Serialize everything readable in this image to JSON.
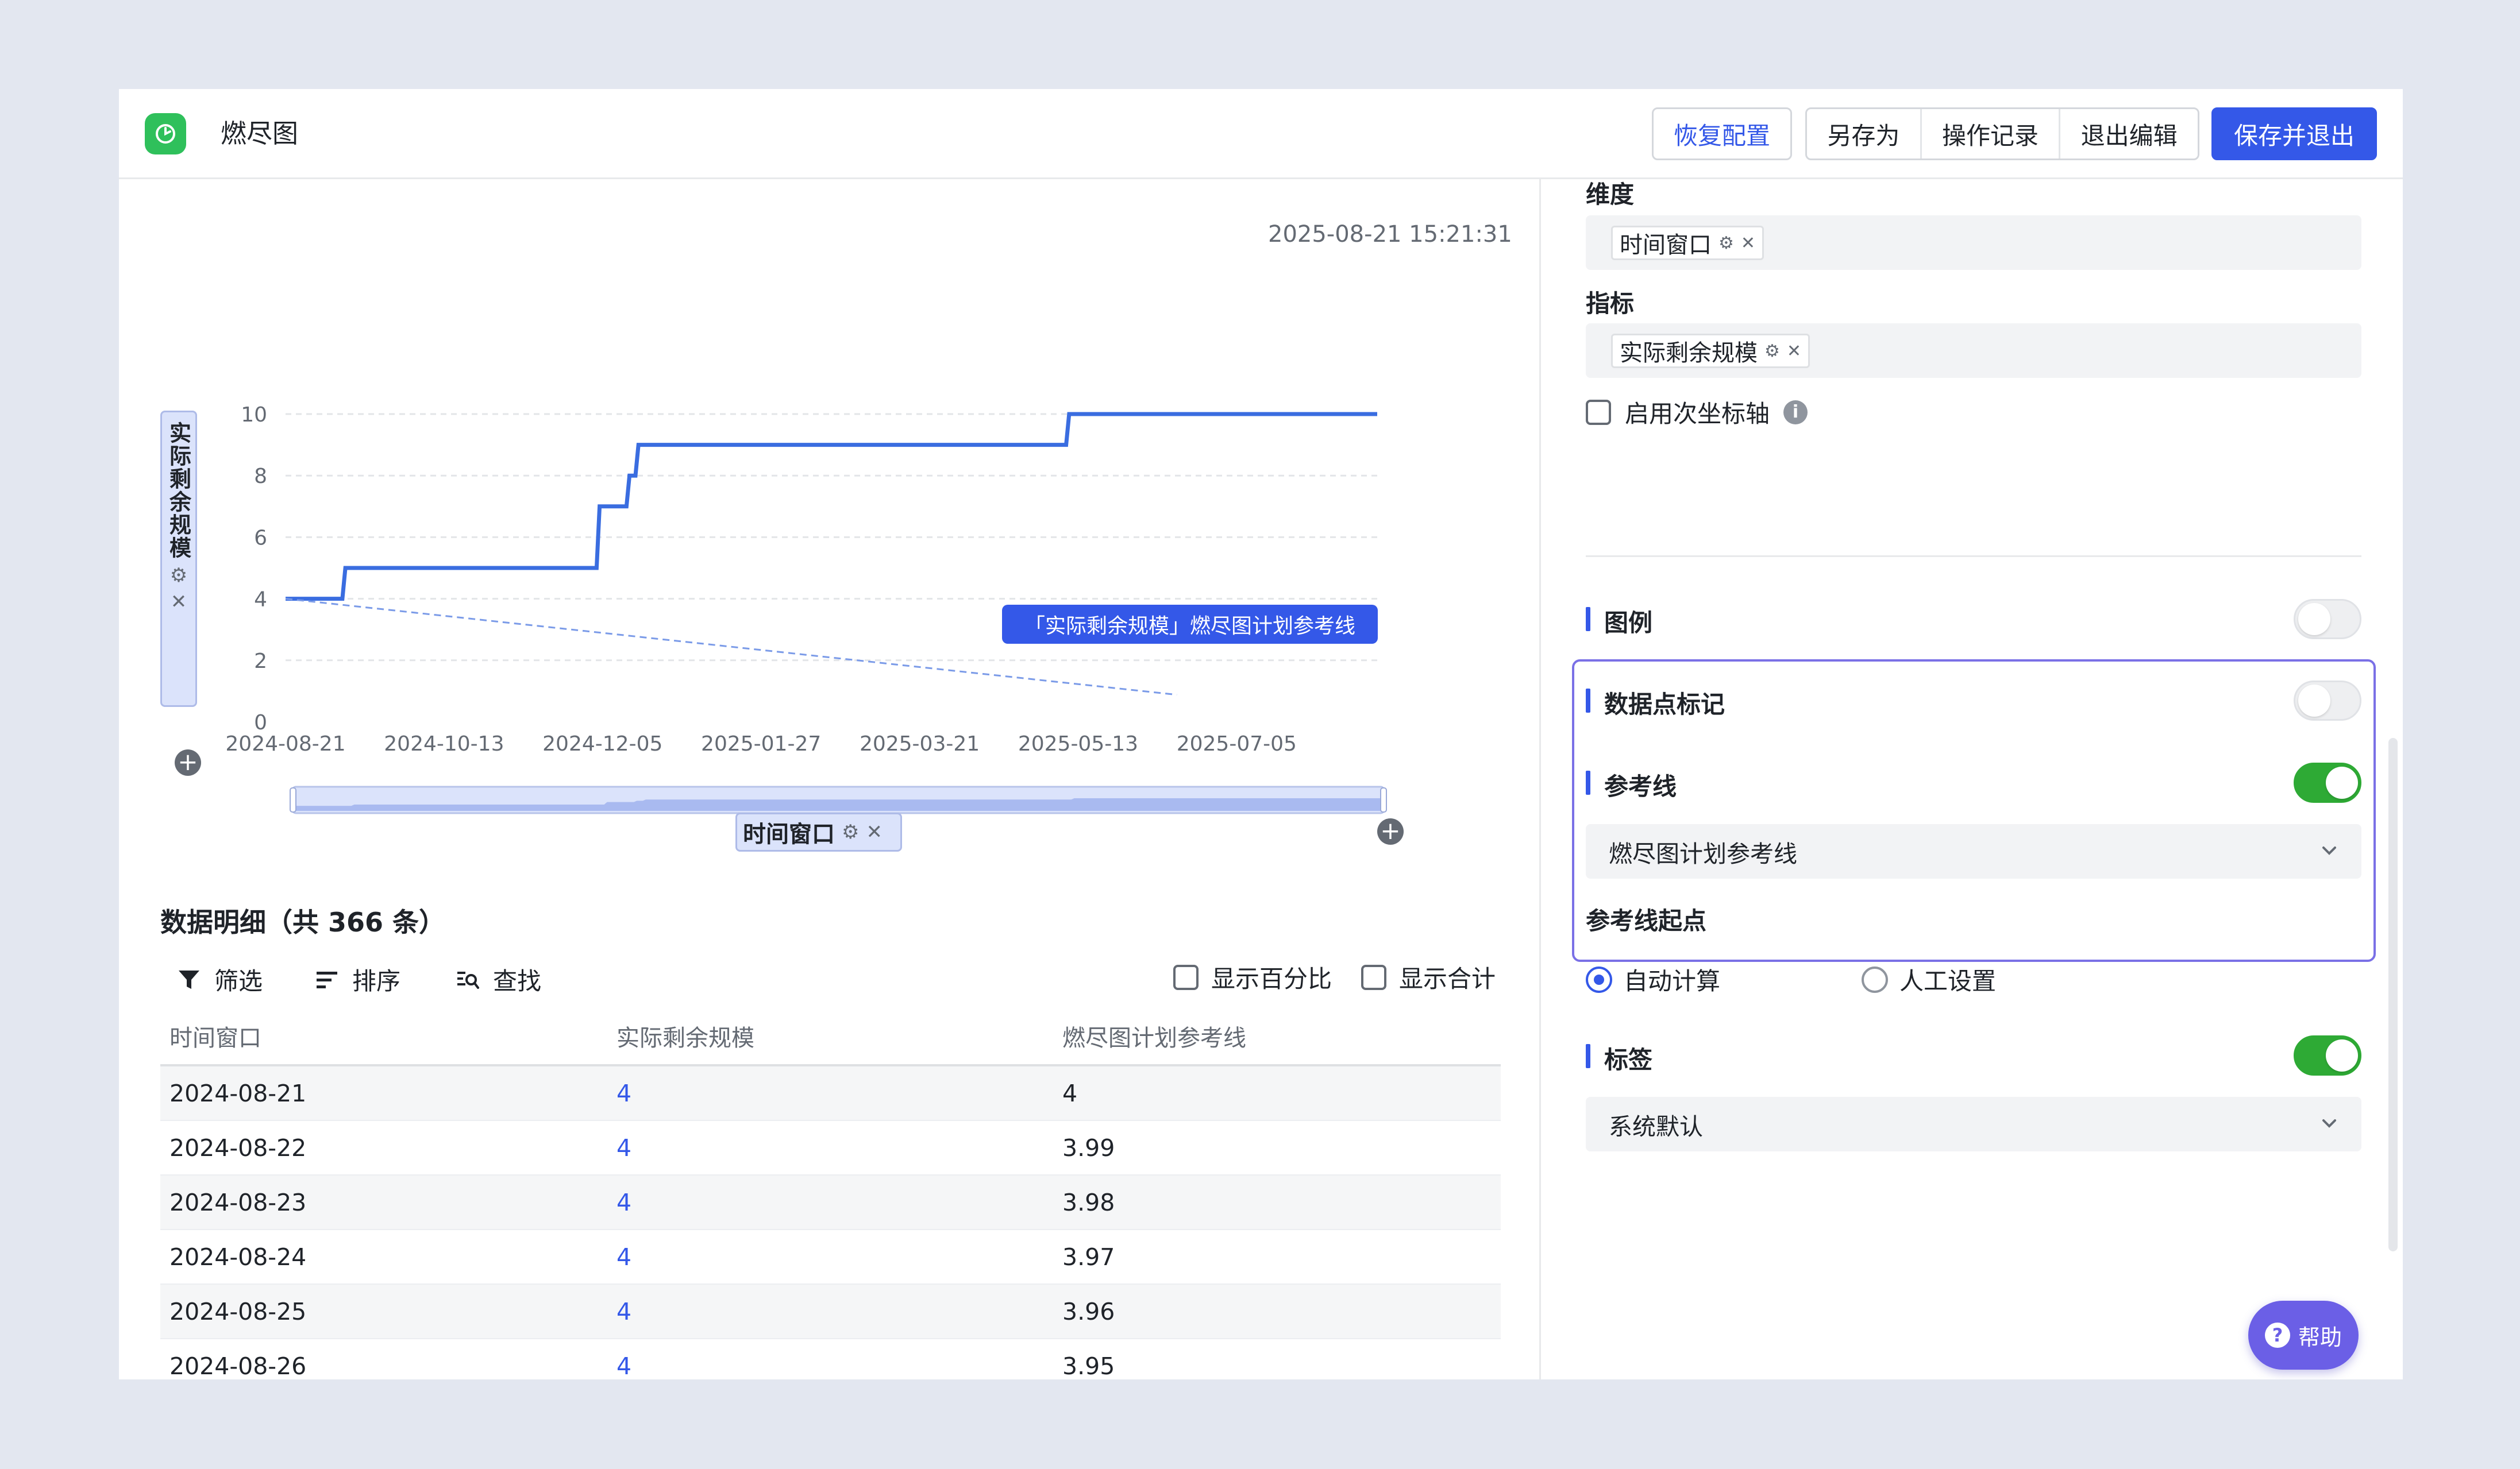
{
  "header": {
    "title": "燃尽图",
    "buttons": {
      "restore": "恢复配置",
      "save_as": "另存为",
      "history": "操作记录",
      "exit_edit": "退出编辑",
      "save_exit": "保存并退出"
    }
  },
  "chart": {
    "timestamp": "2025-08-21 15:21:31",
    "y_axis_field": "实际剩余规模",
    "x_axis_field": "时间窗口",
    "reference_tooltip": "「实际剩余规模」燃尽图计划参考线",
    "icons": {
      "settings": "gear-icon",
      "remove": "close-icon",
      "add": "plus-circle-icon"
    }
  },
  "chart_data": {
    "type": "line",
    "xlabel": "时间窗口",
    "ylabel": "实际剩余规模",
    "x_ticks": [
      "2024-08-21",
      "2024-10-13",
      "2024-12-05",
      "2025-01-27",
      "2025-03-21",
      "2025-05-13",
      "2025-07-05"
    ],
    "y_ticks": [
      0,
      2,
      4,
      6,
      8,
      10
    ],
    "xlim": [
      "2024-08-21",
      "2025-08-21"
    ],
    "ylim": [
      0,
      10
    ],
    "grid": true,
    "series": [
      {
        "name": "实际剩余规模",
        "style": "step",
        "color": "#3a6de0",
        "x": [
          "2024-08-21",
          "2024-09-09",
          "2024-09-10",
          "2024-12-03",
          "2024-12-04",
          "2024-12-13",
          "2024-12-14",
          "2024-12-16",
          "2024-12-17",
          "2025-05-09",
          "2025-05-10",
          "2025-08-21"
        ],
        "y": [
          4,
          4,
          5,
          5,
          7,
          7,
          8,
          8,
          9,
          9,
          10,
          10
        ]
      },
      {
        "name": "燃尽图计划参考线",
        "style": "dashed",
        "color": "#7b9be8",
        "x": [
          "2024-08-21",
          "2025-06-15"
        ],
        "y": [
          4,
          0.88
        ]
      }
    ]
  },
  "detail": {
    "title": "数据明细（共 366 条）",
    "toolbar": {
      "filter": "筛选",
      "sort": "排序",
      "find": "查找"
    },
    "options": {
      "show_percent": "显示百分比",
      "show_total": "显示合计"
    },
    "columns": [
      "时间窗口",
      "实际剩余规模",
      "燃尽图计划参考线"
    ],
    "rows": [
      [
        "2024-08-21",
        "4",
        "4"
      ],
      [
        "2024-08-22",
        "4",
        "3.99"
      ],
      [
        "2024-08-23",
        "4",
        "3.98"
      ],
      [
        "2024-08-24",
        "4",
        "3.97"
      ],
      [
        "2024-08-25",
        "4",
        "3.96"
      ],
      [
        "2024-08-26",
        "4",
        "3.95"
      ]
    ]
  },
  "panel": {
    "dimension_label": "维度",
    "dimension_tag": "时间窗口",
    "metric_label": "指标",
    "metric_tag": "实际剩余规模",
    "secondary_axis": "启用次坐标轴",
    "legend": "图例",
    "data_point_marker": "数据点标记",
    "reference_line": "参考线",
    "reference_line_select": "燃尽图计划参考线",
    "reference_start_label": "参考线起点",
    "start_auto": "自动计算",
    "start_manual": "人工设置",
    "labels": "标签",
    "labels_select": "系统默认",
    "help": "帮助",
    "toggles": {
      "legend": false,
      "data_point_marker": false,
      "reference_line": true,
      "labels": true
    },
    "start_mode": "自动计算"
  },
  "colors": {
    "accent": "#3458e8",
    "toggle_on": "#2eaa35",
    "app_icon": "#2fc05b",
    "help": "#6b5fe6",
    "highlight_border": "#7a70e6"
  }
}
